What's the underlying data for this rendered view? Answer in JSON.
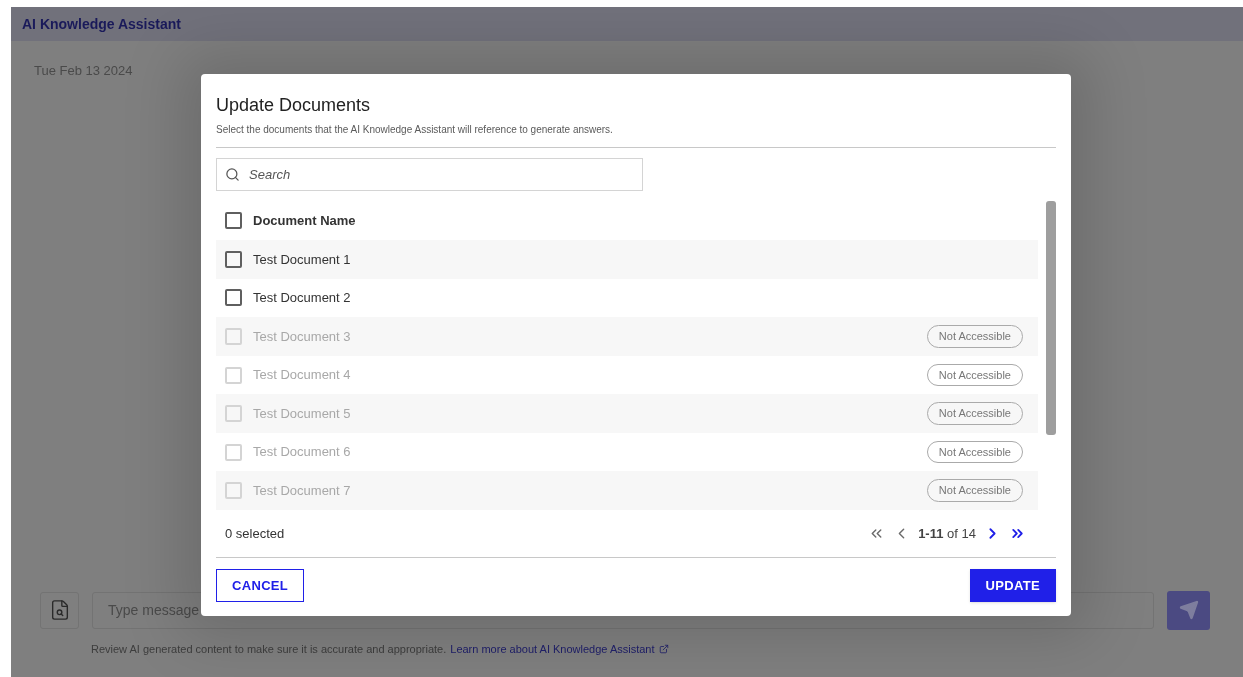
{
  "app": {
    "title": "AI Knowledge Assistant",
    "date": "Tue Feb 13 2024",
    "message_placeholder": "Type message",
    "disclaimer": "Review AI generated content to make sure it is accurate and appropriate.",
    "learn_more_link": "Learn more about AI Knowledge Assistant"
  },
  "dialog": {
    "title": "Update Documents",
    "subtitle": "Select the documents that the AI Knowledge Assistant will reference to generate answers.",
    "search": {
      "placeholder": "Search"
    },
    "header": {
      "label": "Document Name",
      "checked": false
    },
    "documents": [
      {
        "name": "Test Document 1",
        "checked": false,
        "disabled": false
      },
      {
        "name": "Test Document 2",
        "checked": false,
        "disabled": false
      },
      {
        "name": "Test Document 3",
        "checked": false,
        "disabled": true,
        "badge": "Not Accessible"
      },
      {
        "name": "Test Document 4",
        "checked": false,
        "disabled": true,
        "badge": "Not Accessible"
      },
      {
        "name": "Test Document 5",
        "checked": false,
        "disabled": true,
        "badge": "Not Accessible"
      },
      {
        "name": "Test Document 6",
        "checked": false,
        "disabled": true,
        "badge": "Not Accessible"
      },
      {
        "name": "Test Document 7",
        "checked": false,
        "disabled": true,
        "badge": "Not Accessible"
      }
    ],
    "selected_count": "0 selected",
    "pagination": {
      "range": "1-11",
      "of": "of 14",
      "first_disabled": true,
      "prev_disabled": true,
      "next_disabled": false,
      "last_disabled": false
    },
    "buttons": {
      "cancel": "CANCEL",
      "update": "UPDATE"
    }
  }
}
